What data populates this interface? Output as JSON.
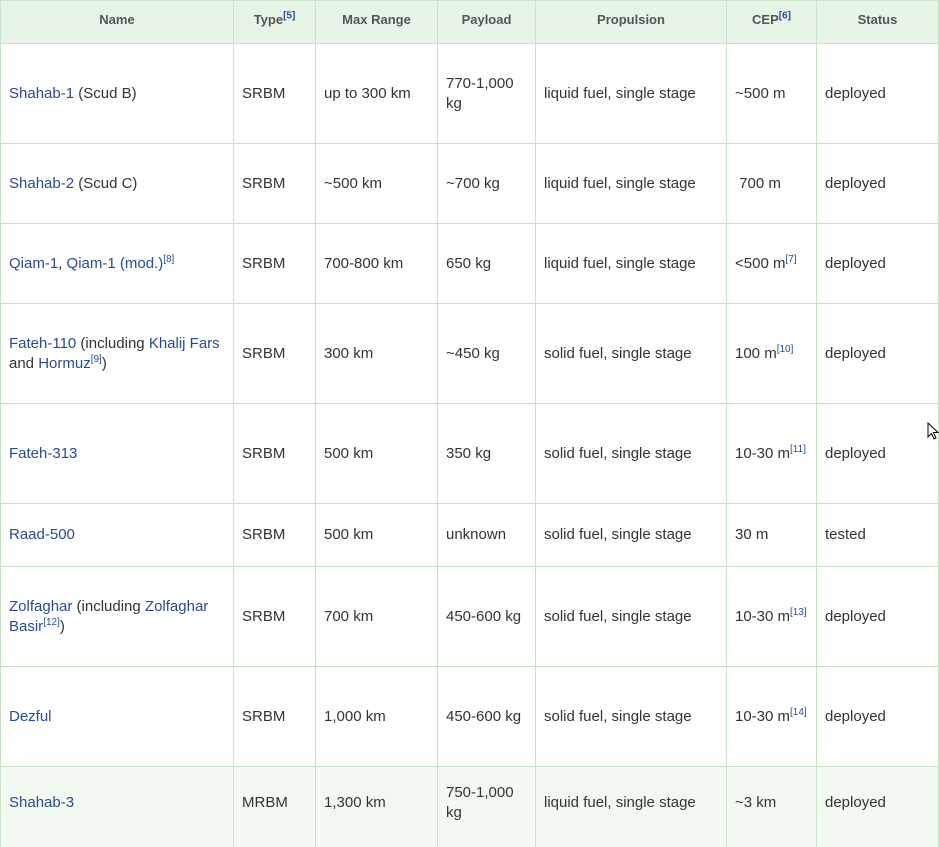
{
  "header": {
    "name": "Name",
    "type": "Type",
    "type_ref": "[5]",
    "max_range": "Max Range",
    "payload": "Payload",
    "propulsion": "Propulsion",
    "cep": "CEP",
    "cep_ref": "[6]",
    "status": "Status"
  },
  "rows": [
    {
      "name_link": "Shahab-1",
      "name_rest": " (Scud B)",
      "type": "SRBM",
      "range": "up to 300 km",
      "payload": "770-1,000 kg",
      "propulsion": "liquid fuel, single stage",
      "cep": "~500 m",
      "status": "deployed"
    },
    {
      "name_link": "Shahab-2",
      "name_rest": " (Scud C)",
      "type": "SRBM",
      "range": "~500 km",
      "payload": "~700 kg",
      "propulsion": "liquid fuel, single stage",
      "cep": " 700 m",
      "status": "deployed"
    },
    {
      "name_link": "Qiam-1",
      "name_sep": ", ",
      "name_link2": "Qiam-1 (mod.)",
      "name_ref": "[8]",
      "type": "SRBM",
      "range": "700-800 km",
      "payload": "650 kg",
      "propulsion": "liquid fuel, single stage",
      "cep": "<500 m",
      "cep_ref": "[7]",
      "status": "deployed"
    },
    {
      "name_link": "Fateh-110",
      "name_mid": " (including ",
      "name_link2": "Khalij Fars",
      "name_and": " and ",
      "name_link3": "Hormuz",
      "name_ref": "[9]",
      "name_close": ")",
      "type": "SRBM",
      "range": "300 km",
      "payload": "~450 kg",
      "propulsion": "solid fuel, single stage",
      "cep": "100 m",
      "cep_ref": "[10]",
      "status": "deployed"
    },
    {
      "name_link": "Fateh-313",
      "type": "SRBM",
      "range": "500 km",
      "payload": "350 kg",
      "propulsion": "solid fuel, single stage",
      "cep": "10-30 m",
      "cep_ref": "[11]",
      "status": "deployed"
    },
    {
      "name_link": "Raad-500",
      "type": "SRBM",
      "range": "500 km",
      "payload": "unknown",
      "propulsion": "solid fuel, single stage",
      "cep": "30 m",
      "status": "tested"
    },
    {
      "name_link": "Zolfaghar",
      "name_mid": " (including ",
      "name_link2": "Zolfaghar Basir",
      "name_ref": "[12]",
      "name_close": ")",
      "type": "SRBM",
      "range": "700 km",
      "payload": "450-600 kg",
      "propulsion": "solid fuel, single stage",
      "cep": "10-30 m",
      "cep_ref": "[13]",
      "status": "deployed"
    },
    {
      "name_link": "Dezful",
      "type": "SRBM",
      "range": "1,000 km",
      "payload": "450-600 kg",
      "propulsion": "solid fuel, single stage",
      "cep": "10-30 m",
      "cep_ref": "[14]",
      "status": "deployed"
    },
    {
      "name_link": "Shahab-3",
      "type": "MRBM",
      "range": "1,300 km",
      "payload": "750-1,000 kg",
      "propulsion": "liquid fuel, single stage",
      "cep": "~3 km",
      "status": "deployed"
    }
  ],
  "colors": {
    "link": "#2a4b8d",
    "header_bg": "#e8f4e8",
    "border": "#c9e3c9",
    "highlight_row": "#f1f9f1"
  },
  "cursor_icon": "mouse-pointer-icon"
}
